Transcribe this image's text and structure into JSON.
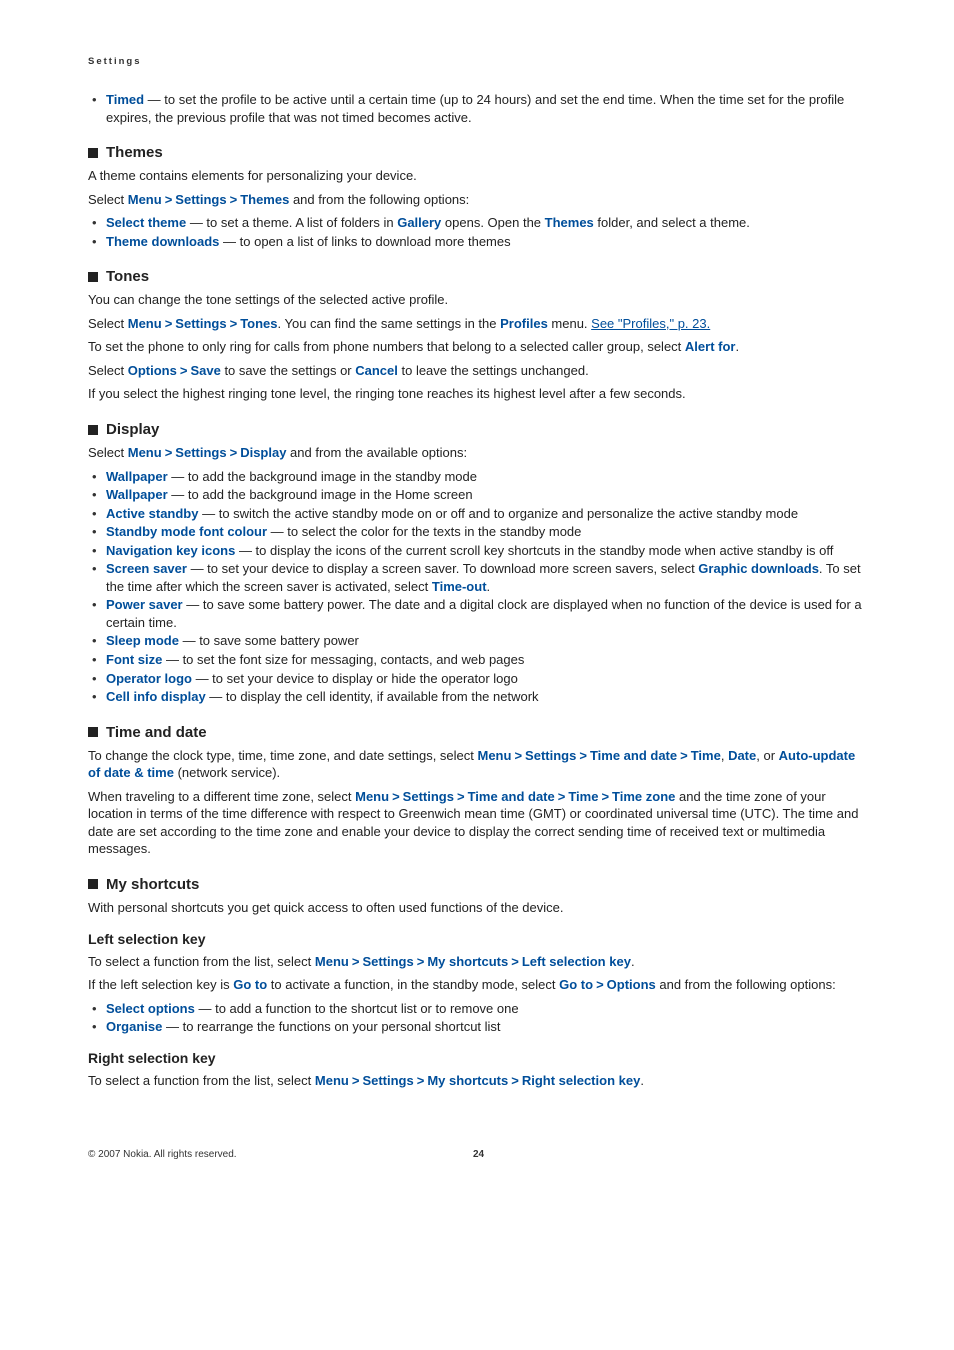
{
  "header": "Settings",
  "timed": {
    "label": "Timed",
    "text": " — to set the profile to be active until a certain time (up to 24 hours) and set the end time. When the time set for the profile expires, the previous profile that was not timed becomes active."
  },
  "themes": {
    "title": "Themes",
    "intro": "A theme contains elements for personalizing your device.",
    "select_pre": "Select ",
    "menu": "Menu",
    "settings": "Settings",
    "themes_kw": "Themes",
    "after": " and from the following options:",
    "items": [
      {
        "label": "Select theme",
        "t1": " — to set a theme. A list of folders in ",
        "kw2": "Gallery",
        "t2": " opens. Open the ",
        "kw3": "Themes",
        "t3": " folder, and select a theme."
      },
      {
        "label": "Theme downloads",
        "t1": " — to open a list of links to download more themes"
      }
    ]
  },
  "tones": {
    "title": "Tones",
    "p1": "You can change the tone settings of the selected active profile.",
    "p2_pre": "Select ",
    "menu": "Menu",
    "settings": "Settings",
    "tones": "Tones",
    "p2_mid": ". You can find the same settings in the ",
    "profiles": "Profiles",
    "p2_mid2": " menu. ",
    "see_link": "See \"Profiles,\" p. 23.",
    "p3_pre": "To set the phone to only ring for calls from phone numbers that belong to a selected caller group, select ",
    "alert_for": "Alert for",
    "p3_post": ".",
    "p4_pre": "Select ",
    "options": "Options",
    "save": "Save",
    "p4_mid": " to save the settings or ",
    "cancel": "Cancel",
    "p4_post": " to leave the settings unchanged.",
    "p5": "If you select the highest ringing tone level, the ringing tone reaches its highest level after a few seconds."
  },
  "display": {
    "title": "Display",
    "p1_pre": "Select ",
    "menu": "Menu",
    "settings": "Settings",
    "display": "Display",
    "p1_post": " and from the available options:",
    "items": [
      {
        "label": "Wallpaper",
        "t": " — to add the background image in the standby mode"
      },
      {
        "label": "Wallpaper",
        "t": " — to add the background image in the Home screen"
      },
      {
        "label": "Active standby",
        "t": " — to switch the active standby mode on or off and to organize and personalize the active standby mode"
      },
      {
        "label": "Standby mode font colour",
        "t": " — to select the color for the texts in the standby mode"
      },
      {
        "label": "Navigation key icons",
        "t": " — to display the icons of the current scroll key shortcuts in the standby mode when active standby is off"
      },
      {
        "label": "Screen saver",
        "t": " — to set your device to display a screen saver. To download more screen savers, select ",
        "kw2": "Graphic downloads",
        "t2": ". To set the time after which the screen saver is activated, select ",
        "kw3": "Time-out",
        "t3": "."
      },
      {
        "label": "Power saver",
        "t": " — to save some battery power. The date and a digital clock are displayed when no function of the device is used for a certain time."
      },
      {
        "label": "Sleep mode",
        "t": " — to save some battery power"
      },
      {
        "label": "Font size",
        "t": " — to set the font size for messaging, contacts, and web pages"
      },
      {
        "label": "Operator logo",
        "t": " — to set your device to display or hide the operator logo"
      },
      {
        "label": "Cell info display",
        "t": " — to display the cell identity, if available from the network"
      }
    ]
  },
  "timedate": {
    "title": "Time and date",
    "p1_pre": "To change the clock type, time, time zone, and date settings, select ",
    "menu": "Menu",
    "settings": "Settings",
    "td": "Time and date",
    "time": "Time",
    "date": "Date",
    "p1_mid": ", or ",
    "auto": "Auto-update of date & time",
    "p1_post": " (network service).",
    "p2_pre": "When traveling to a different time zone, select ",
    "tz": "Time zone",
    "p2_post": " and the time zone of your location in terms of the time difference with respect to Greenwich mean time (GMT) or coordinated universal time (UTC). The time and date are set according to the time zone and enable your device to display the correct sending time of received text or multimedia messages.",
    "comma": ", "
  },
  "shortcuts": {
    "title": "My shortcuts",
    "intro": "With personal shortcuts you get quick access to often used functions of the device.",
    "left": {
      "title": "Left selection key",
      "p1_pre": "To select a function from the list, select ",
      "menu": "Menu",
      "settings": "Settings",
      "ms": "My shortcuts",
      "lsk": "Left selection key",
      "p1_post": ".",
      "p2_pre": "If the left selection key is ",
      "goto": "Go to",
      "p2_mid": " to activate a function, in the standby mode, select ",
      "options": "Options",
      "p2_post": " and from the following options:",
      "items": [
        {
          "label": "Select options",
          "t": " — to add a function to the shortcut list or to remove one"
        },
        {
          "label": "Organise",
          "t": " — to rearrange the functions on your personal shortcut list"
        }
      ]
    },
    "right": {
      "title": "Right selection key",
      "p1_pre": "To select a function from the list, select ",
      "menu": "Menu",
      "settings": "Settings",
      "ms": "My shortcuts",
      "rsk": "Right selection key",
      "p1_post": "."
    }
  },
  "footer": {
    "copyright": "© 2007 Nokia. All rights reserved.",
    "page": "24"
  },
  "gt": ">"
}
